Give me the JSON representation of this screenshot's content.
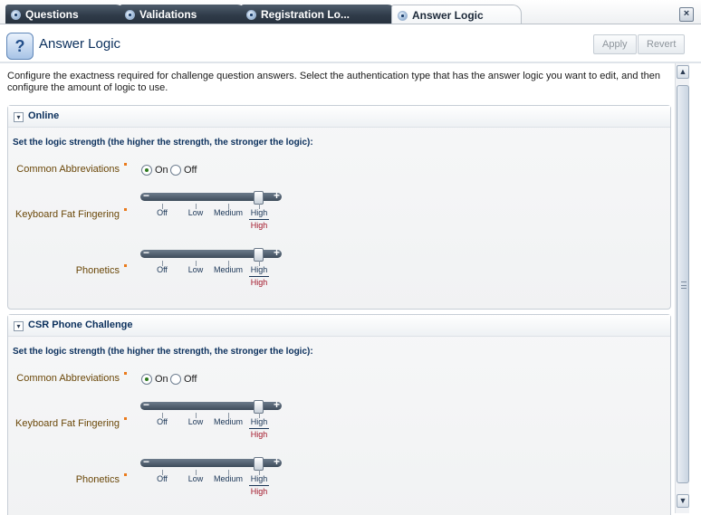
{
  "tabs": [
    {
      "label": "Questions",
      "active": false
    },
    {
      "label": "Validations",
      "active": false
    },
    {
      "label": "Registration Lo...",
      "active": false
    },
    {
      "label": "Answer Logic",
      "active": true
    }
  ],
  "header": {
    "title": "Answer Logic",
    "icon_glyph": "?",
    "apply_label": "Apply",
    "revert_label": "Revert"
  },
  "intro": "Configure the exactness required for challenge question answers. Select the authentication type that has the answer logic you want to edit, and then configure the amount of logic to use.",
  "colors": {
    "accent": "#0a2f5c",
    "label": "#6a4708",
    "required": "#ea7a1b",
    "selected_value": "#a3172a"
  },
  "sections": [
    {
      "title": "Online",
      "subtitle": "Set the logic strength (the higher the strength, the stronger the logic):",
      "abbrev_label": "Common Abbreviations",
      "abbrev_on": "On",
      "abbrev_off": "Off",
      "abbrev_selected": "On",
      "fat_label": "Keyboard Fat Fingering",
      "phon_label": "Phonetics",
      "levels": [
        "Off",
        "Low",
        "Medium",
        "High"
      ],
      "fat_value": "High",
      "phon_value": "High"
    },
    {
      "title": "CSR Phone Challenge",
      "subtitle": "Set the logic strength (the higher the strength, the stronger the logic):",
      "abbrev_label": "Common Abbreviations",
      "abbrev_on": "On",
      "abbrev_off": "Off",
      "abbrev_selected": "On",
      "fat_label": "Keyboard Fat Fingering",
      "phon_label": "Phonetics",
      "levels": [
        "Off",
        "Low",
        "Medium",
        "High"
      ],
      "fat_value": "High",
      "phon_value": "High"
    }
  ],
  "icons": {
    "tab": "questions-icon",
    "close": "close-icon",
    "collapse": "chevron-down-icon"
  }
}
